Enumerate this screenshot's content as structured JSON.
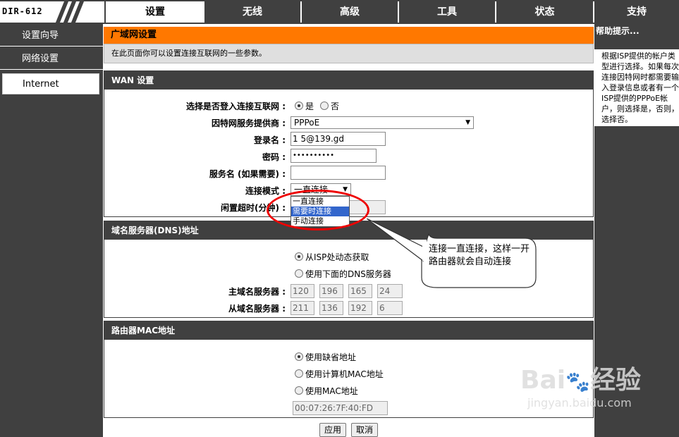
{
  "logo": {
    "model": "DIR-612"
  },
  "tabs": [
    {
      "label": "设置"
    },
    {
      "label": "无线"
    },
    {
      "label": "高级"
    },
    {
      "label": "工具"
    },
    {
      "label": "状态"
    },
    {
      "label": "支持"
    }
  ],
  "leftnav": [
    {
      "label": "设置向导"
    },
    {
      "label": "网络设置"
    },
    {
      "label": "Internet"
    }
  ],
  "page": {
    "title": "广域网设置",
    "description": "在此页面你可以设置连接互联网的一些参数。"
  },
  "wan": {
    "header": "WAN 设置",
    "login_label": "选择是否登入连接互联网 :",
    "yes": "是",
    "no": "否",
    "isp_label": "因特网服务提供商 :",
    "isp_value": "PPPoE",
    "username_label": "登录名 :",
    "username_value": "1        5@139.gd",
    "password_label": "密码 :",
    "password_value": "••••••••••",
    "service_label": "服务名 (如果需要) :",
    "service_value": "",
    "mode_label": "连接模式 :",
    "mode_value": "一直连接",
    "mode_options": [
      "一直连接",
      "需要时连接",
      "手动连接"
    ],
    "idle_label": "闲置超时(分钟) :"
  },
  "dns": {
    "header": "域名服务器(DNS)地址",
    "opt_auto": "从ISP处动态获取",
    "opt_manual": "使用下面的DNS服务器",
    "primary_label": "主域名服务器 :",
    "primary": [
      "120",
      "196",
      "165",
      "24"
    ],
    "secondary_label": "从域名服务器 :",
    "secondary": [
      "211",
      "136",
      "192",
      "6"
    ]
  },
  "mac": {
    "header": "路由器MAC地址",
    "opt_default": "使用缺省地址",
    "opt_pc": "使用计算机MAC地址",
    "opt_custom": "使用MAC地址",
    "value": "00:07:26:7F:40:FD"
  },
  "buttons": {
    "apply": "应用",
    "cancel": "取消"
  },
  "help": {
    "title": "帮助提示...",
    "body": "根据ISP提供的帐户类型进行选择。如果每次连接因特网时都需要输入登录信息或者有一个ISP提供的PPPoE帐户，则选择是，否则，选择否。"
  },
  "annotation": {
    "text": "连接一直连接，这样一开路由器就会自动连接"
  },
  "watermark": {
    "brand": "Bai",
    "brand2": "经验",
    "url": "jingyan.baidu.com"
  },
  "colors": {
    "accent": "#ff7800",
    "dark": "#404040",
    "highlight": "#3366cc",
    "annotation": "#e00000"
  }
}
